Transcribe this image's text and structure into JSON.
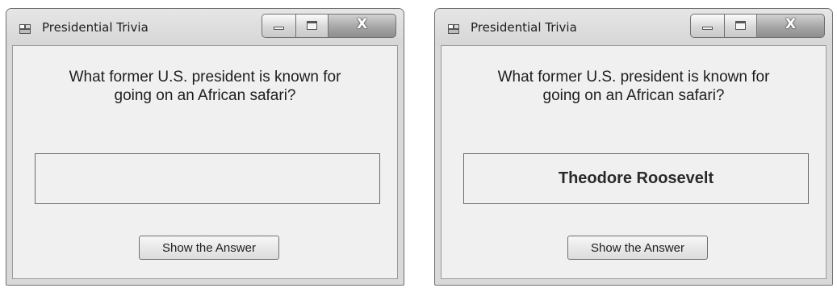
{
  "windows": [
    {
      "title": "Presidential Trivia",
      "close_glyph": "X",
      "icons": [
        "app-form-icon",
        "minimize-icon",
        "maximize-icon",
        "close-icon"
      ],
      "question_line1": "What former U.S. president is known for",
      "question_line2": "going on an African safari?",
      "answer": "",
      "button_label": "Show the Answer"
    },
    {
      "title": "Presidential Trivia",
      "close_glyph": "X",
      "icons": [
        "app-form-icon",
        "minimize-icon",
        "maximize-icon",
        "close-icon"
      ],
      "question_line1": "What former U.S. president is known for",
      "question_line2": "going on an African safari?",
      "answer": "Theodore Roosevelt",
      "button_label": "Show the Answer"
    }
  ]
}
